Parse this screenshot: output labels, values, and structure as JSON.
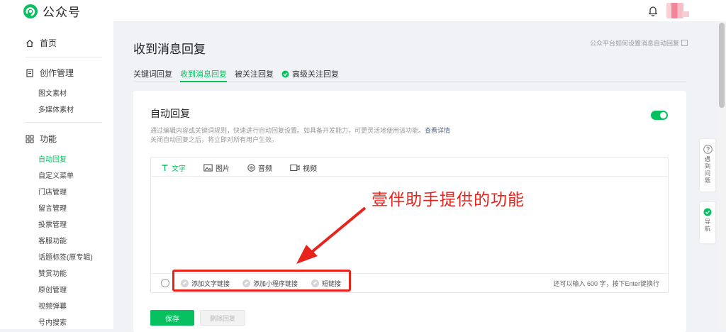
{
  "header": {
    "app_title": "公众号"
  },
  "sidebar": {
    "home_label": "首页",
    "creation_label": "创作管理",
    "creation_items": [
      "图文素材",
      "多媒体素材"
    ],
    "function_label": "功能",
    "function_items": [
      "自动回复",
      "自定义菜单",
      "门店管理",
      "留言管理",
      "投票管理",
      "客服功能",
      "话题标签(原专辑)",
      "赞赏功能",
      "原创管理",
      "视频弹幕",
      "号内搜索"
    ],
    "active_item": "自动回复"
  },
  "page": {
    "title": "收到消息回复",
    "help_link": "公众平台如何设置消息自动回复",
    "tabs": [
      "关键词回复",
      "收到消息回复",
      "被关注回复",
      "高级关注回复"
    ],
    "active_tab": "收到消息回复"
  },
  "auto_reply": {
    "title": "自动回复",
    "desc_line1": "通过编辑内容或关键词规则，快速进行自动回复设置。如具备开发能力，可更灵活地使用该功能。",
    "details_link": "查看详情",
    "desc_line2": "关闭自动回复之后，将立即对所有用户生效。",
    "enabled": true
  },
  "editor": {
    "tabs": [
      "文字",
      "图片",
      "音频",
      "视频"
    ],
    "active_tab": "文字",
    "footer_links": [
      "添加文字链接",
      "添加小程序链接",
      "短链接"
    ],
    "char_count": "还可以输入 600 字，按下Enter键换行"
  },
  "actions": {
    "save_label": "保存",
    "delete_label": "删除回复"
  },
  "annotation": {
    "text": "壹伴助手提供的功能",
    "color": "#e8231b"
  },
  "float_panel": {
    "help_text": "遇到问题",
    "nav_text": "导航"
  },
  "colors": {
    "accent": "#07c160",
    "link": "#576b95"
  }
}
